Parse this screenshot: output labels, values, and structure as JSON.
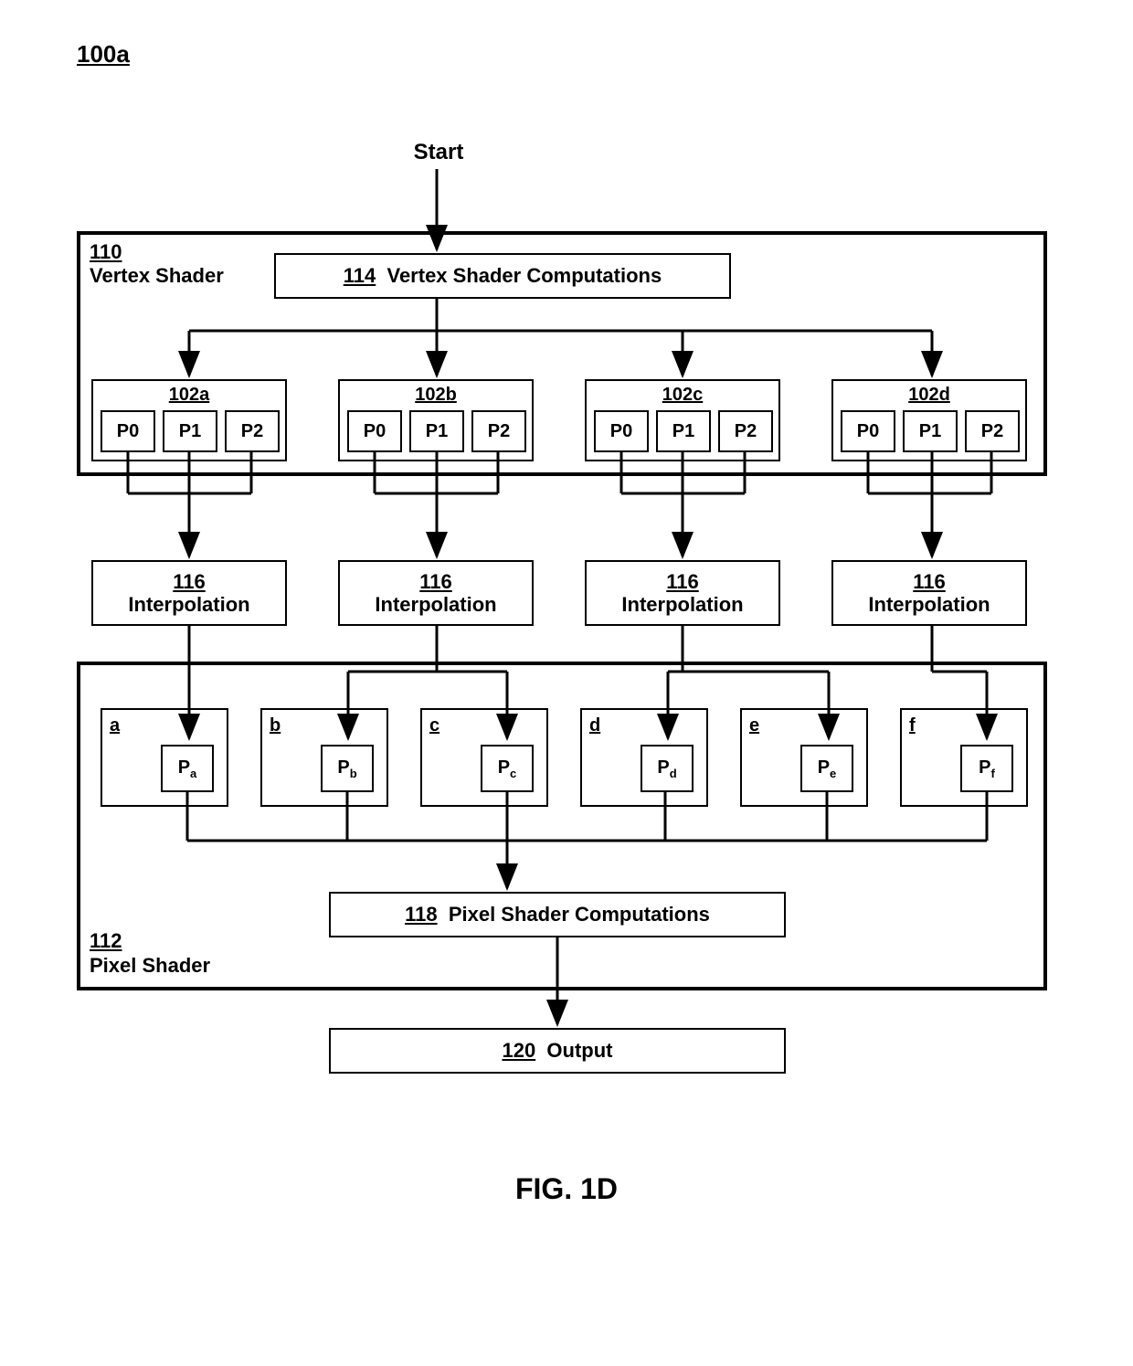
{
  "figure_id": "100a",
  "start_label": "Start",
  "vertex_shader": {
    "ref": "110",
    "label": "Vertex Shader",
    "computations_ref": "114",
    "computations_label": "Vertex Shader Computations",
    "groups": [
      {
        "ref": "102a",
        "cells": [
          "P0",
          "P1",
          "P2"
        ]
      },
      {
        "ref": "102b",
        "cells": [
          "P0",
          "P1",
          "P2"
        ]
      },
      {
        "ref": "102c",
        "cells": [
          "P0",
          "P1",
          "P2"
        ]
      },
      {
        "ref": "102d",
        "cells": [
          "P0",
          "P1",
          "P2"
        ]
      }
    ]
  },
  "interpolation": {
    "ref": "116",
    "label": "Interpolation"
  },
  "pixel_shader": {
    "ref": "112",
    "label": "Pixel Shader",
    "computations_ref": "118",
    "computations_label": "Pixel Shader Computations",
    "pboxes": [
      {
        "ref": "a",
        "val_base": "P",
        "val_sub": "a"
      },
      {
        "ref": "b",
        "val_base": "P",
        "val_sub": "b"
      },
      {
        "ref": "c",
        "val_base": "P",
        "val_sub": "c"
      },
      {
        "ref": "d",
        "val_base": "P",
        "val_sub": "d"
      },
      {
        "ref": "e",
        "val_base": "P",
        "val_sub": "e"
      },
      {
        "ref": "f",
        "val_base": "P",
        "val_sub": "f"
      }
    ]
  },
  "output": {
    "ref": "120",
    "label": "Output"
  },
  "figure_title": "FIG. 1D"
}
